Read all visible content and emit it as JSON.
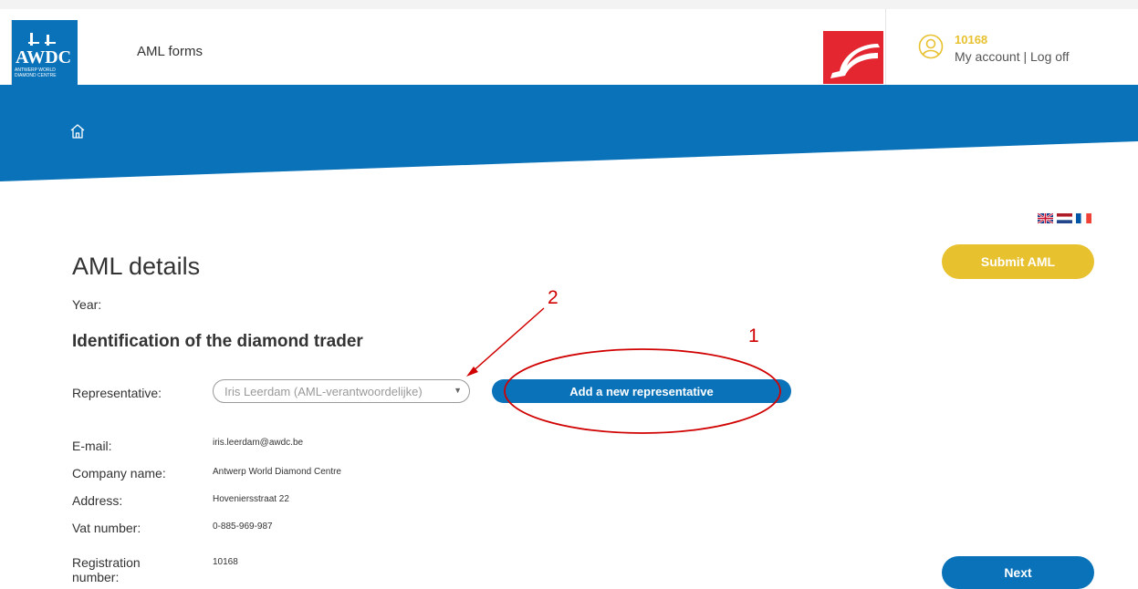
{
  "header": {
    "logo_text": "AWDC",
    "logo_sub": "ANTWERP WORLD DIAMOND CENTRE",
    "app_name": "AML forms",
    "account_id": "10168",
    "my_account": "My account",
    "separator": " | ",
    "log_off": "Log off"
  },
  "banner": {
    "color": "#0a72b9"
  },
  "languages": [
    "English",
    "Nederlands",
    "Français"
  ],
  "page": {
    "title": "AML details",
    "submit_label": "Submit AML",
    "year_label": "Year:",
    "section_title": "Identification of the diamond trader",
    "representative_label": "Representative:",
    "representative_value": "Iris Leerdam (AML-verantwoordelijke)",
    "add_rep_label": "Add a new representative",
    "fields": [
      {
        "label": "E-mail:",
        "value": "iris.leerdam@awdc.be"
      },
      {
        "label": "Company name:",
        "value": "Antwerp World Diamond Centre"
      },
      {
        "label": "Address:",
        "value": "Hoveniersstraat 22"
      },
      {
        "label": "Vat number:",
        "value": "0-885-969-987"
      },
      {
        "label": "Registration number:",
        "value": "10168"
      }
    ],
    "next_label": "Next"
  },
  "annotations": {
    "one": "1",
    "two": "2",
    "color": "#d10000"
  },
  "colors": {
    "accent_yellow": "#e8c12f",
    "brand_blue": "#0a72b9"
  }
}
